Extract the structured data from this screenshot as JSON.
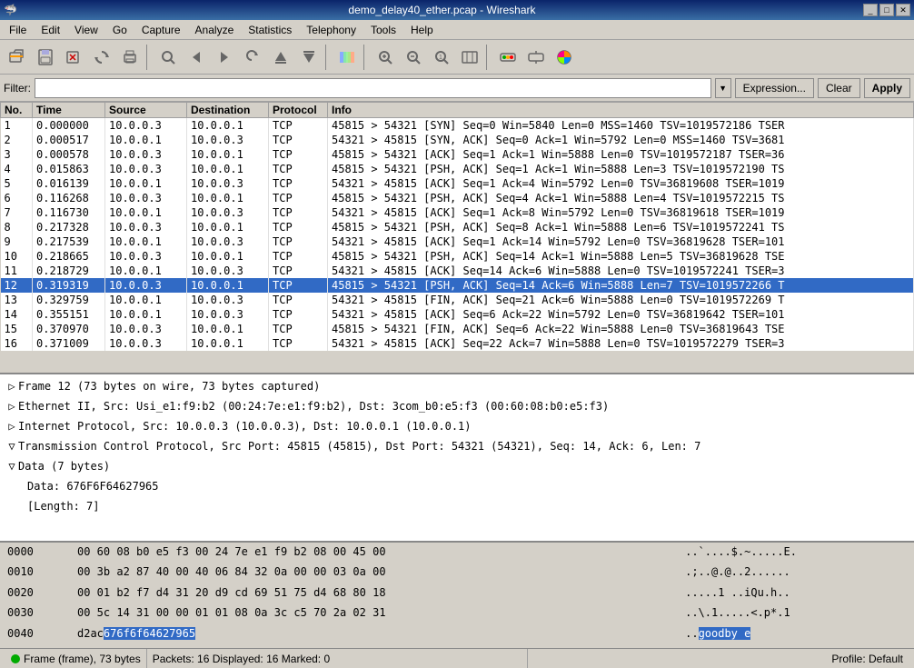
{
  "window": {
    "title": "demo_delay40_ether.pcap - Wireshark",
    "icon": "🦈"
  },
  "titlebar": {
    "controls": [
      "_",
      "□",
      "✕"
    ]
  },
  "menubar": {
    "items": [
      "File",
      "Edit",
      "View",
      "Go",
      "Capture",
      "Analyze",
      "Statistics",
      "Telephony",
      "Tools",
      "Help"
    ]
  },
  "toolbar": {
    "buttons": [
      {
        "name": "open-button",
        "icon": "📂"
      },
      {
        "name": "save-button",
        "icon": "💾"
      },
      {
        "name": "close-button",
        "icon": "✕"
      },
      {
        "name": "reload-button",
        "icon": "🔄"
      },
      {
        "name": "print-button",
        "icon": "🖨️"
      },
      {
        "name": "find-button",
        "icon": "🔍"
      },
      {
        "name": "prev-button",
        "icon": "◀"
      },
      {
        "name": "next-button",
        "icon": "▶"
      },
      {
        "name": "prev-capture-button",
        "icon": "⟲"
      },
      {
        "name": "up-button",
        "icon": "▲"
      },
      {
        "name": "down-button",
        "icon": "▼"
      },
      {
        "name": "colorize-button",
        "icon": "■"
      },
      {
        "name": "zoom-in-button",
        "icon": "🔎"
      },
      {
        "name": "zoom-out-button",
        "icon": "🔍"
      },
      {
        "name": "normal-size-button",
        "icon": "⊡"
      },
      {
        "name": "resize-button",
        "icon": "⊞"
      },
      {
        "name": "capture-interfaces-button",
        "icon": "⋮"
      },
      {
        "name": "capture-options-button",
        "icon": "⚙"
      },
      {
        "name": "colorize-packet-button",
        "icon": "🎨"
      }
    ]
  },
  "filterbar": {
    "label": "Filter:",
    "input_value": "",
    "input_placeholder": "",
    "buttons": [
      {
        "name": "expression-button",
        "label": "Expression..."
      },
      {
        "name": "clear-button",
        "label": "Clear"
      },
      {
        "name": "apply-button",
        "label": "Apply"
      }
    ]
  },
  "packet_list": {
    "columns": [
      "No.",
      "Time",
      "Source",
      "Destination",
      "Protocol",
      "Info"
    ],
    "rows": [
      {
        "no": "1",
        "time": "0.000000",
        "src": "10.0.0.3",
        "dst": "10.0.0.1",
        "proto": "TCP",
        "info": "45815 > 54321 [SYN] Seq=0 Win=5840 Len=0 MSS=1460 TSV=1019572186 TSER",
        "selected": false
      },
      {
        "no": "2",
        "time": "0.000517",
        "src": "10.0.0.1",
        "dst": "10.0.0.3",
        "proto": "TCP",
        "info": "54321 > 45815 [SYN, ACK] Seq=0 Ack=1 Win=5792 Len=0 MSS=1460 TSV=3681",
        "selected": false
      },
      {
        "no": "3",
        "time": "0.000578",
        "src": "10.0.0.3",
        "dst": "10.0.0.1",
        "proto": "TCP",
        "info": "45815 > 54321 [ACK] Seq=1 Ack=1 Win=5888 Len=0 TSV=1019572187 TSER=36",
        "selected": false
      },
      {
        "no": "4",
        "time": "0.015863",
        "src": "10.0.0.3",
        "dst": "10.0.0.1",
        "proto": "TCP",
        "info": "45815 > 54321 [PSH, ACK] Seq=1 Ack=1 Win=5888 Len=3 TSV=1019572190 TS",
        "selected": false
      },
      {
        "no": "5",
        "time": "0.016139",
        "src": "10.0.0.1",
        "dst": "10.0.0.3",
        "proto": "TCP",
        "info": "54321 > 45815 [ACK] Seq=1 Ack=4 Win=5792 Len=0 TSV=36819608 TSER=1019",
        "selected": false
      },
      {
        "no": "6",
        "time": "0.116268",
        "src": "10.0.0.3",
        "dst": "10.0.0.1",
        "proto": "TCP",
        "info": "45815 > 54321 [PSH, ACK] Seq=4 Ack=1 Win=5888 Len=4 TSV=1019572215 TS",
        "selected": false
      },
      {
        "no": "7",
        "time": "0.116730",
        "src": "10.0.0.1",
        "dst": "10.0.0.3",
        "proto": "TCP",
        "info": "54321 > 45815 [ACK] Seq=1 Ack=8 Win=5792 Len=0 TSV=36819618 TSER=1019",
        "selected": false
      },
      {
        "no": "8",
        "time": "0.217328",
        "src": "10.0.0.3",
        "dst": "10.0.0.1",
        "proto": "TCP",
        "info": "45815 > 54321 [PSH, ACK] Seq=8 Ack=1 Win=5888 Len=6 TSV=1019572241 TS",
        "selected": false
      },
      {
        "no": "9",
        "time": "0.217539",
        "src": "10.0.0.1",
        "dst": "10.0.0.3",
        "proto": "TCP",
        "info": "54321 > 45815 [ACK] Seq=1 Ack=14 Win=5792 Len=0 TSV=36819628 TSER=101",
        "selected": false
      },
      {
        "no": "10",
        "time": "0.218665",
        "src": "10.0.0.3",
        "dst": "10.0.0.1",
        "proto": "TCP",
        "info": "45815 > 54321 [PSH, ACK] Seq=14 Ack=1 Win=5888 Len=5 TSV=36819628 TSE",
        "selected": false
      },
      {
        "no": "11",
        "time": "0.218729",
        "src": "10.0.0.1",
        "dst": "10.0.0.3",
        "proto": "TCP",
        "info": "54321 > 45815 [ACK] Seq=14 Ack=6 Win=5888 Len=0 TSV=1019572241 TSER=3",
        "selected": false
      },
      {
        "no": "12",
        "time": "0.319319",
        "src": "10.0.0.3",
        "dst": "10.0.0.1",
        "proto": "TCP",
        "info": "45815 > 54321 [PSH, ACK] Seq=14 Ack=6 Win=5888 Len=7 TSV=1019572266 T",
        "selected": true
      },
      {
        "no": "13",
        "time": "0.329759",
        "src": "10.0.0.1",
        "dst": "10.0.0.3",
        "proto": "TCP",
        "info": "54321 > 45815 [FIN, ACK] Seq=21 Ack=6 Win=5888 Len=0 TSV=1019572269 T",
        "selected": false
      },
      {
        "no": "14",
        "time": "0.355151",
        "src": "10.0.0.1",
        "dst": "10.0.0.3",
        "proto": "TCP",
        "info": "54321 > 45815 [ACK] Seq=6 Ack=22 Win=5792 Len=0 TSV=36819642 TSER=101",
        "selected": false
      },
      {
        "no": "15",
        "time": "0.370970",
        "src": "10.0.0.3",
        "dst": "10.0.0.1",
        "proto": "TCP",
        "info": "45815 > 54321 [FIN, ACK] Seq=6 Ack=22 Win=5888 Len=0 TSV=36819643 TSE",
        "selected": false
      },
      {
        "no": "16",
        "time": "0.371009",
        "src": "10.0.0.3",
        "dst": "10.0.0.1",
        "proto": "TCP",
        "info": "54321 > 45815 [ACK] Seq=22 Ack=7 Win=5888 Len=0 TSV=1019572279 TSER=3",
        "selected": false
      }
    ]
  },
  "tree_panel": {
    "items": [
      {
        "id": "frame",
        "indent": 0,
        "expanded": false,
        "text": "Frame 12 (73 bytes on wire, 73 bytes captured)",
        "highlighted": false
      },
      {
        "id": "ethernet",
        "indent": 0,
        "expanded": false,
        "text": "Ethernet II, Src: Usi_e1:f9:b2 (00:24:7e:e1:f9:b2), Dst: 3com_b0:e5:f3 (00:60:08:b0:e5:f3)",
        "highlighted": false
      },
      {
        "id": "ip",
        "indent": 0,
        "expanded": false,
        "text": "Internet Protocol, Src: 10.0.0.3 (10.0.0.3), Dst: 10.0.0.1 (10.0.0.1)",
        "highlighted": false
      },
      {
        "id": "tcp",
        "indent": 0,
        "expanded": true,
        "text": "Transmission Control Protocol, Src Port: 45815 (45815), Dst Port: 54321 (54321), Seq: 14, Ack: 6, Len: 7",
        "highlighted": false
      },
      {
        "id": "data",
        "indent": 0,
        "expanded": true,
        "text": "Data (7 bytes)",
        "highlighted": false
      },
      {
        "id": "data-val",
        "indent": 1,
        "expanded": false,
        "text": "Data: 676F6F64627965",
        "highlighted": false,
        "sub": true
      },
      {
        "id": "data-len",
        "indent": 1,
        "expanded": false,
        "text": "[Length: 7]",
        "highlighted": false,
        "sub": true
      }
    ]
  },
  "hex_panel": {
    "rows": [
      {
        "offset": "0000",
        "bytes": "00 60 08 b0 e5 f3 00 24  7e e1 f9 b2 08 00 45 00",
        "ascii": "..`....$.~.....E.",
        "highlight_start": -1,
        "highlight_end": -1
      },
      {
        "offset": "0010",
        "bytes": "00 3b a2 87 40 00 40 06  84 32 0a 00 00 03 0a 00",
        "ascii": ".;..@.@..2......",
        "highlight_start": -1,
        "highlight_end": -1
      },
      {
        "offset": "0020",
        "bytes": "00 01 b2 f7 d4 31 20 d9  cd 69 51 75 d4 68 80 18",
        "ascii": ".....1 ..iQu.h..",
        "highlight_start": -1,
        "highlight_end": -1
      },
      {
        "offset": "0030",
        "bytes": "00 5c 14 31 00 00 01 01  08 0a 3c c5 70 2a 02 31",
        "ascii": "..\\.1.....<.p*.1",
        "highlight_start": -1,
        "highlight_end": -1
      },
      {
        "offset": "0040",
        "bytes": "d2 ac 67 6f 6f 64 62 79  65",
        "ascii": "..goodby e",
        "highlight_start": 2,
        "highlight_end": 8
      }
    ]
  },
  "statusbar": {
    "frame_label": "Frame (frame), 73 bytes",
    "packets_label": "Packets: 16 Displayed: 16 Marked: 0",
    "profile_label": "Profile: Default"
  }
}
